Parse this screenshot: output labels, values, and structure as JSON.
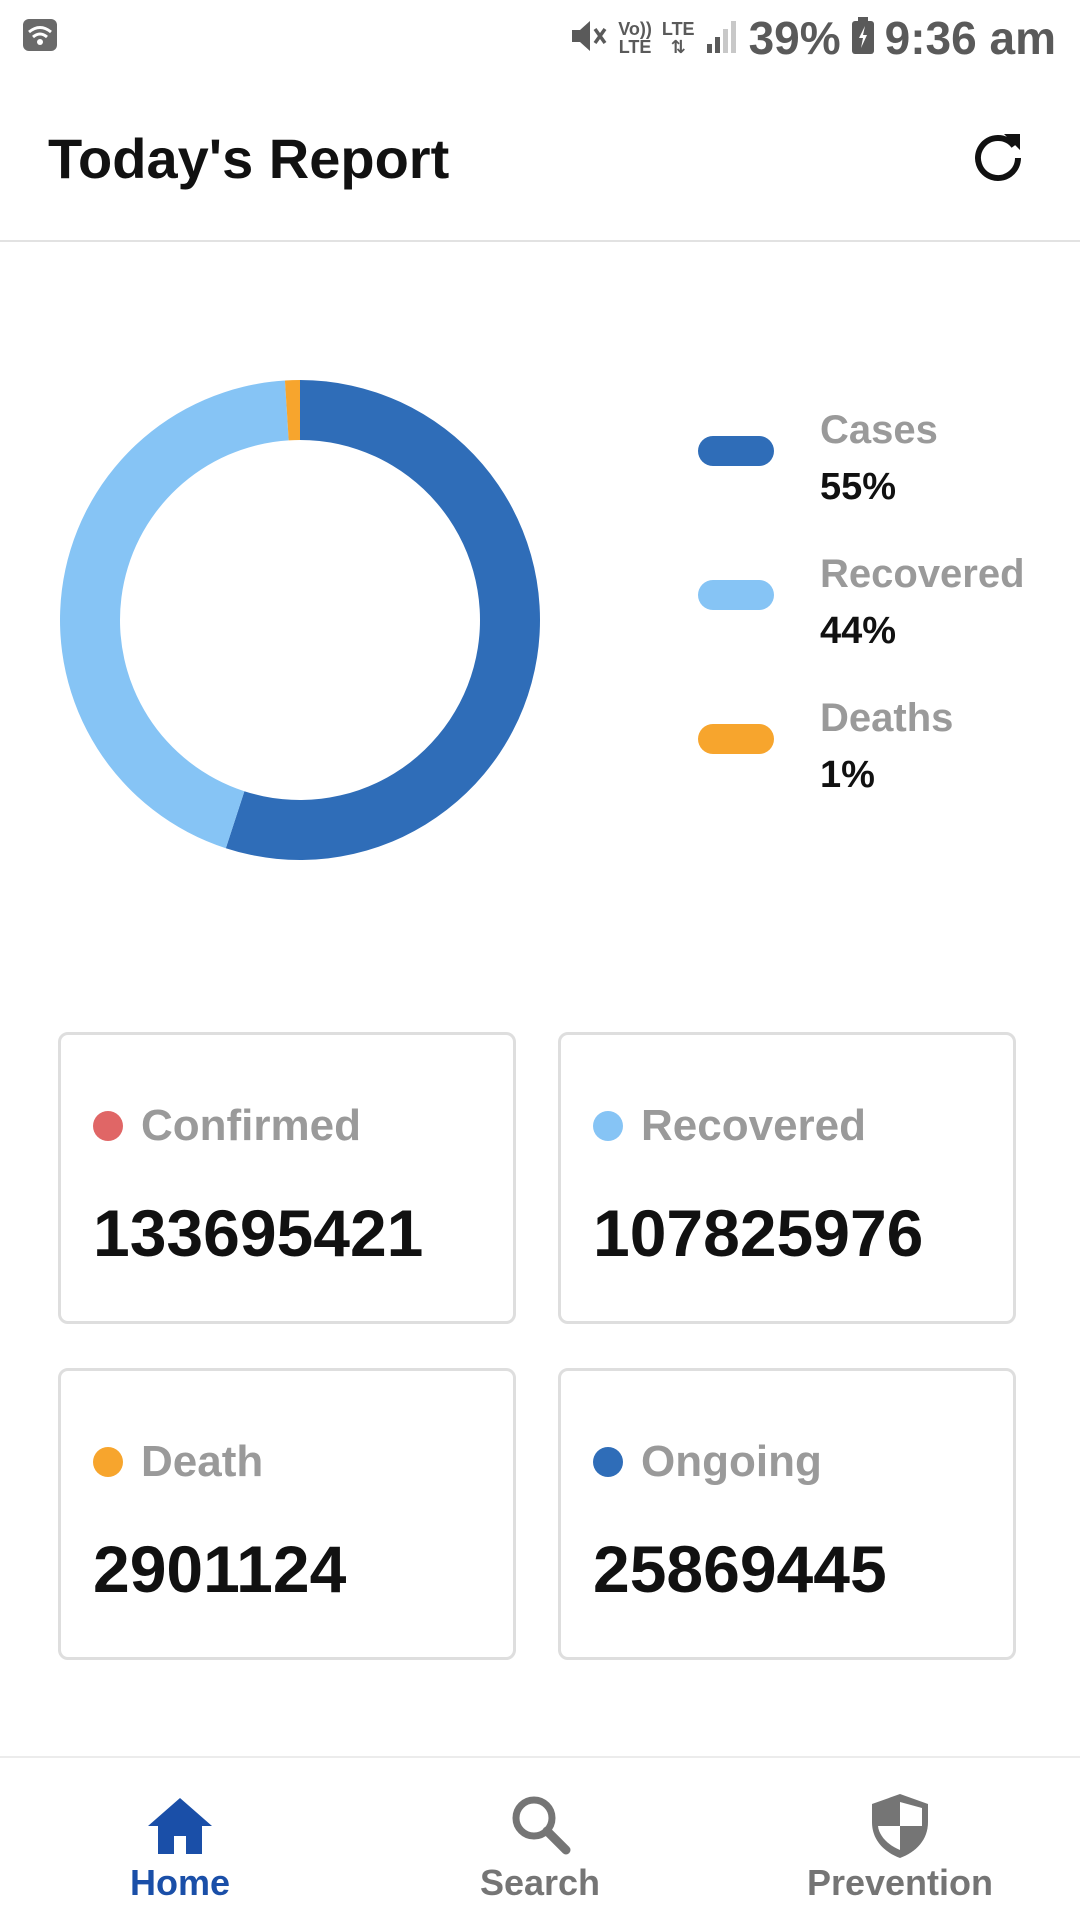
{
  "status_bar": {
    "volte": "Vo))",
    "lte_small": "LTE",
    "lte": "LTE",
    "battery": "39%",
    "time": "9:36 am"
  },
  "app_bar": {
    "title": "Today's Report"
  },
  "chart_data": {
    "type": "pie",
    "donut": true,
    "categories": [
      "Cases",
      "Recovered",
      "Deaths"
    ],
    "values": [
      55,
      44,
      1
    ],
    "value_labels": [
      "55%",
      "44%",
      "1%"
    ],
    "colors": [
      "#2f6db8",
      "#86c4f5",
      "#f7a52d"
    ],
    "legend_position": "right"
  },
  "stats": [
    {
      "label": "Confirmed",
      "value": "133695421",
      "color": "#e06666"
    },
    {
      "label": "Recovered",
      "value": "107825976",
      "color": "#86c4f5"
    },
    {
      "label": "Death",
      "value": "2901124",
      "color": "#f7a52d"
    },
    {
      "label": "Ongoing",
      "value": "25869445",
      "color": "#2f6db8"
    }
  ],
  "bottom_nav": {
    "items": [
      {
        "label": "Home",
        "icon": "home-icon",
        "active": true
      },
      {
        "label": "Search",
        "icon": "search-icon",
        "active": false
      },
      {
        "label": "Prevention",
        "icon": "shield-icon",
        "active": false
      }
    ],
    "active_color": "#1a4fa8",
    "inactive_color": "#757575"
  }
}
